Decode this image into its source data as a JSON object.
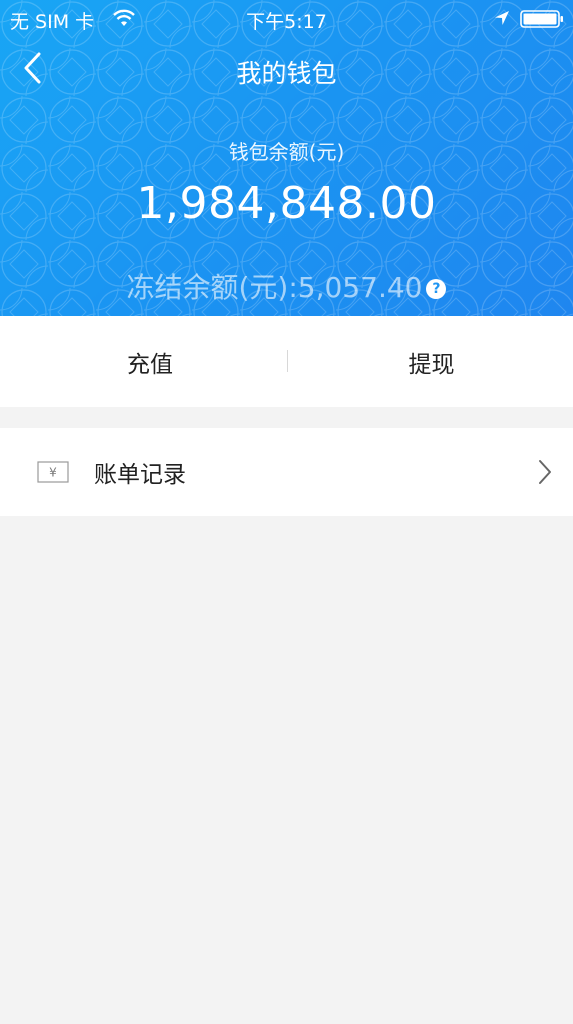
{
  "status_bar": {
    "carrier": "无 SIM 卡",
    "time": "下午5:17"
  },
  "nav": {
    "title": "我的钱包"
  },
  "wallet": {
    "balance_label": "钱包余额(元)",
    "balance_value": "1,984,848.00",
    "frozen_text": "冻结余额(元):5,057.40",
    "help_glyph": "?"
  },
  "actions": {
    "recharge": "充值",
    "withdraw": "提现"
  },
  "list": {
    "bill_records": "账单记录"
  },
  "colors": {
    "header_primary": "#1a95f2",
    "page_background": "#f3f3f3"
  },
  "icons": [
    "wifi-icon",
    "location-icon",
    "battery-icon",
    "back-icon",
    "help-icon",
    "bill-icon",
    "chevron-right-icon"
  ]
}
